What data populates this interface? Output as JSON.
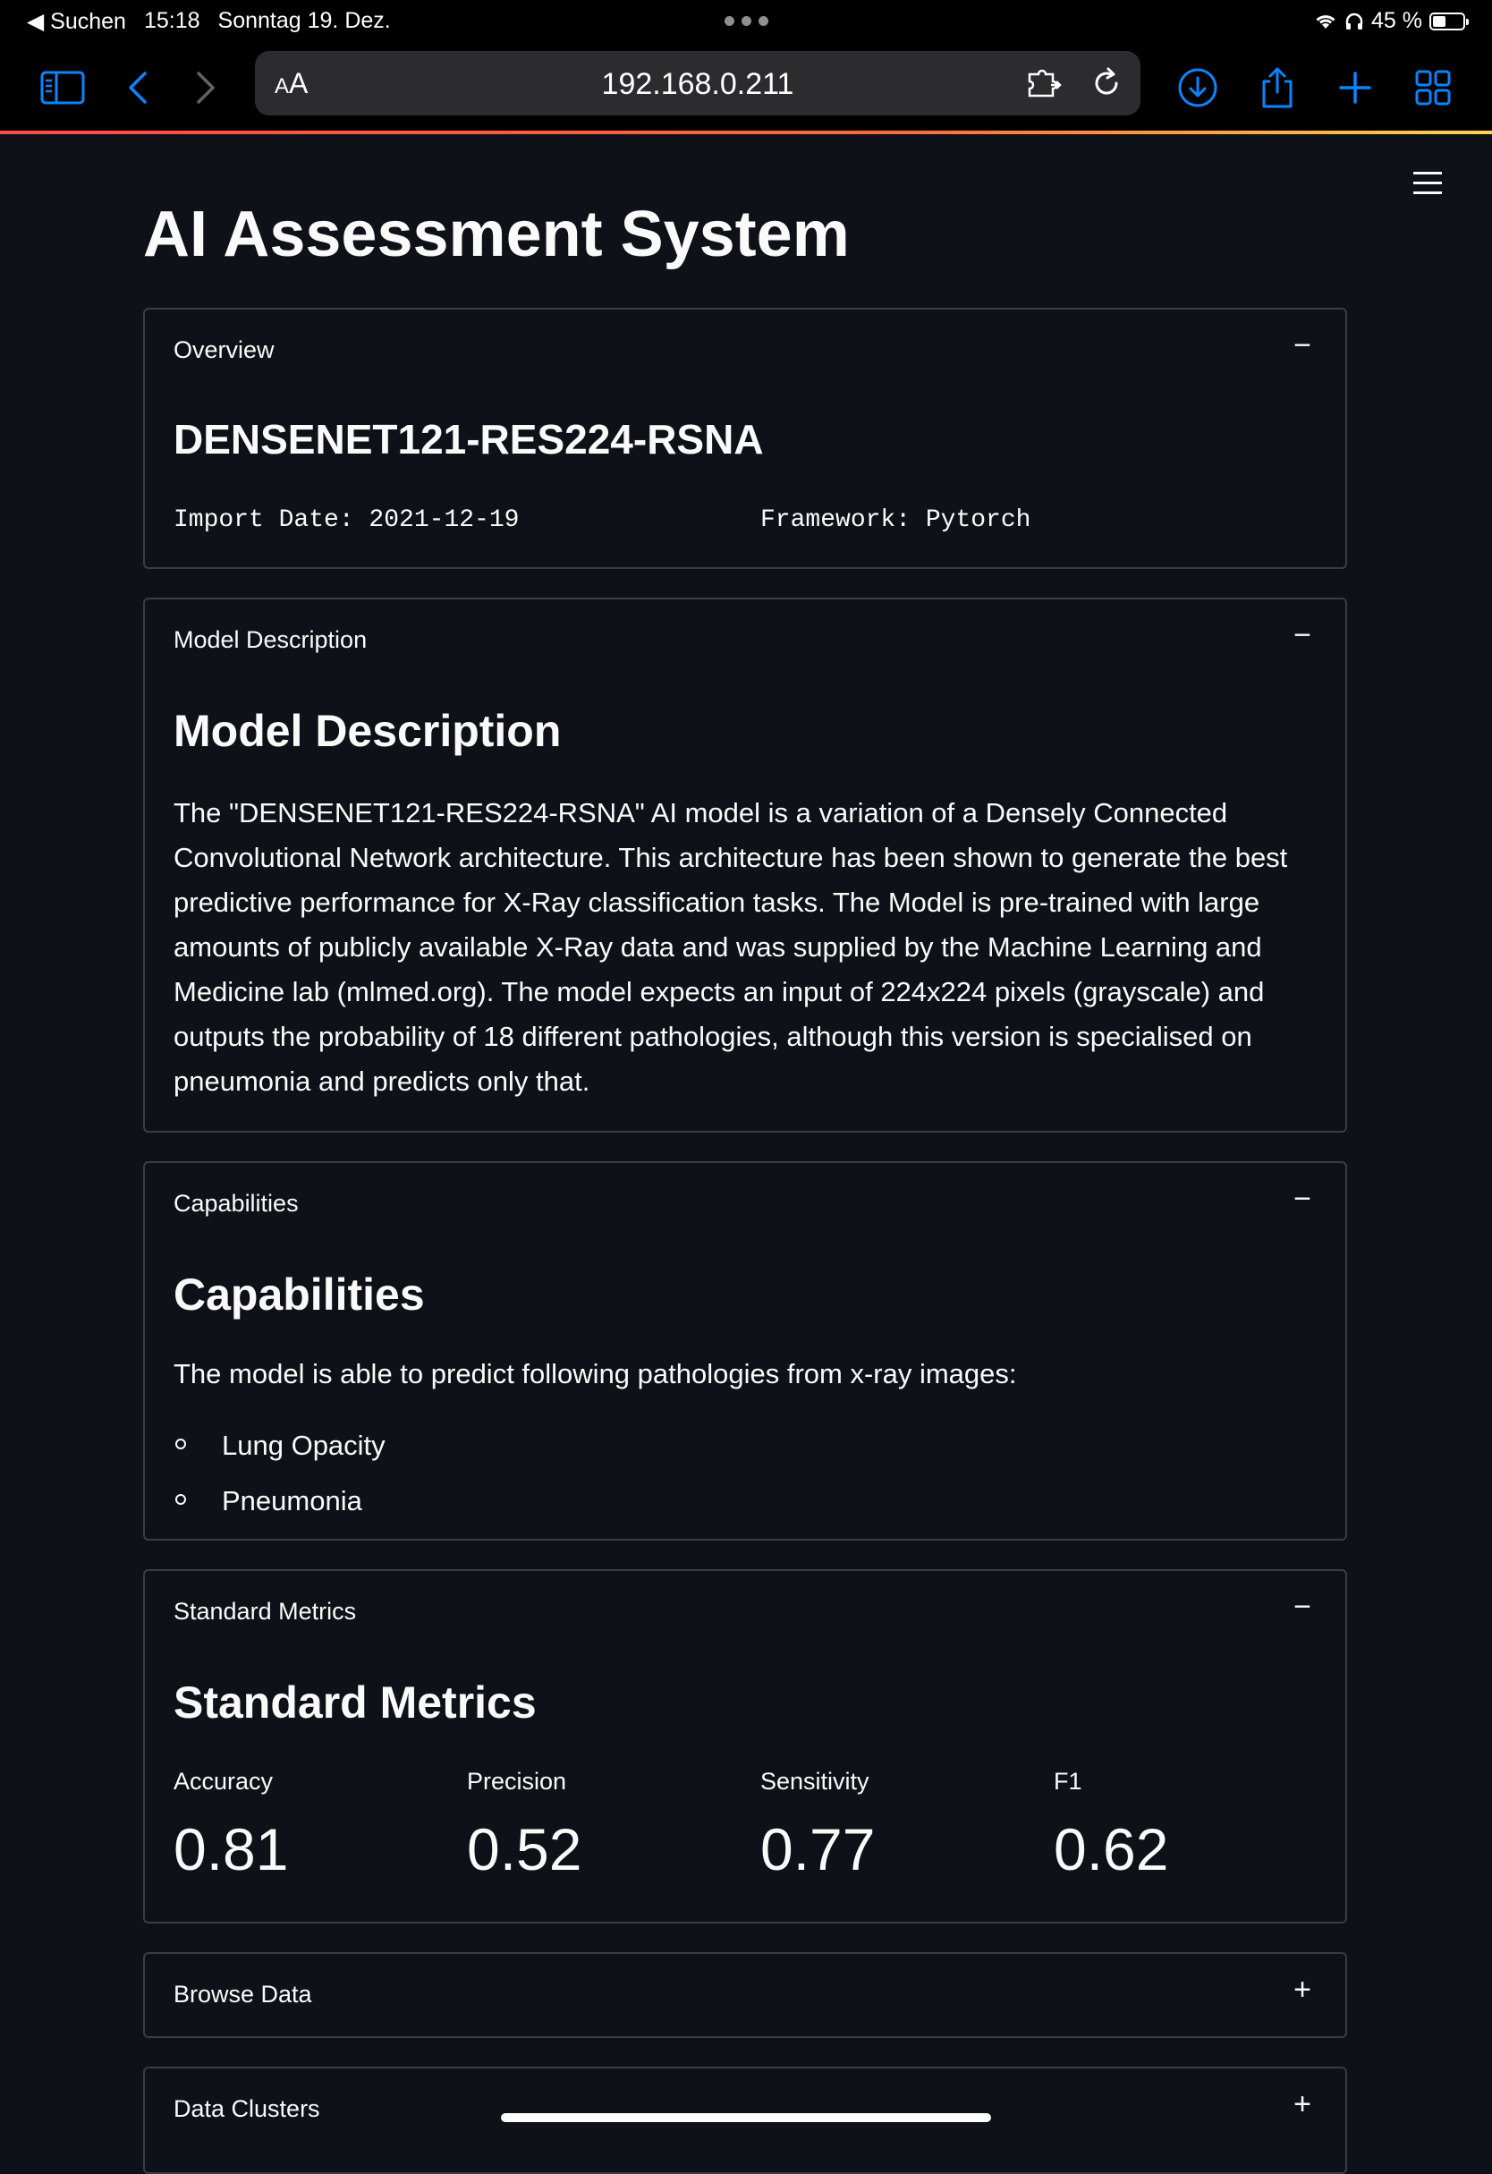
{
  "status_bar": {
    "back_app": "◀ Suchen",
    "time": "15:18",
    "date": "Sonntag 19. Dez.",
    "battery": "45 %",
    "battery_level": 0.45
  },
  "browser": {
    "text_size_label": "AA",
    "url": "192.168.0.211",
    "accent_color": "#0a84ff"
  },
  "page": {
    "title": "AI Assessment System",
    "menu_icon": "hamburger-icon"
  },
  "overview": {
    "header": "Overview",
    "toggle": "−",
    "model_name": "DENSENET121-RES224-RSNA",
    "import_date": "Import Date: 2021-12-19",
    "framework": "Framework: Pytorch"
  },
  "model_description": {
    "header": "Model Description",
    "toggle": "−",
    "heading": "Model Description",
    "text": "The \"DENSENET121-RES224-RSNA\" AI model is a variation of a Densely Connected Convolutional Network architecture. This architecture has been shown to generate the best predictive performance for X-Ray classification tasks. The Model is pre-trained with large amounts of publicly available X-Ray data and was supplied by the Machine Learning and Medicine lab (mlmed.org). The model expects an input of 224x224 pixels (grayscale) and outputs the probability of 18 different pathologies, although this version is specialised on pneumonia and predicts only that."
  },
  "capabilities": {
    "header": "Capabilities",
    "toggle": "−",
    "heading": "Capabilities",
    "intro": "The model is able to predict following pathologies from x-ray images:",
    "items": [
      "Lung Opacity",
      "Pneumonia"
    ]
  },
  "standard_metrics": {
    "header": "Standard Metrics",
    "toggle": "−",
    "heading": "Standard Metrics",
    "metrics": [
      {
        "label": "Accuracy",
        "value": "0.81"
      },
      {
        "label": "Precision",
        "value": "0.52"
      },
      {
        "label": "Sensitivity",
        "value": "0.77"
      },
      {
        "label": "F1",
        "value": "0.62"
      }
    ]
  },
  "browse_data": {
    "header": "Browse Data",
    "toggle": "+"
  },
  "data_clusters": {
    "header": "Data Clusters",
    "toggle": "+"
  }
}
